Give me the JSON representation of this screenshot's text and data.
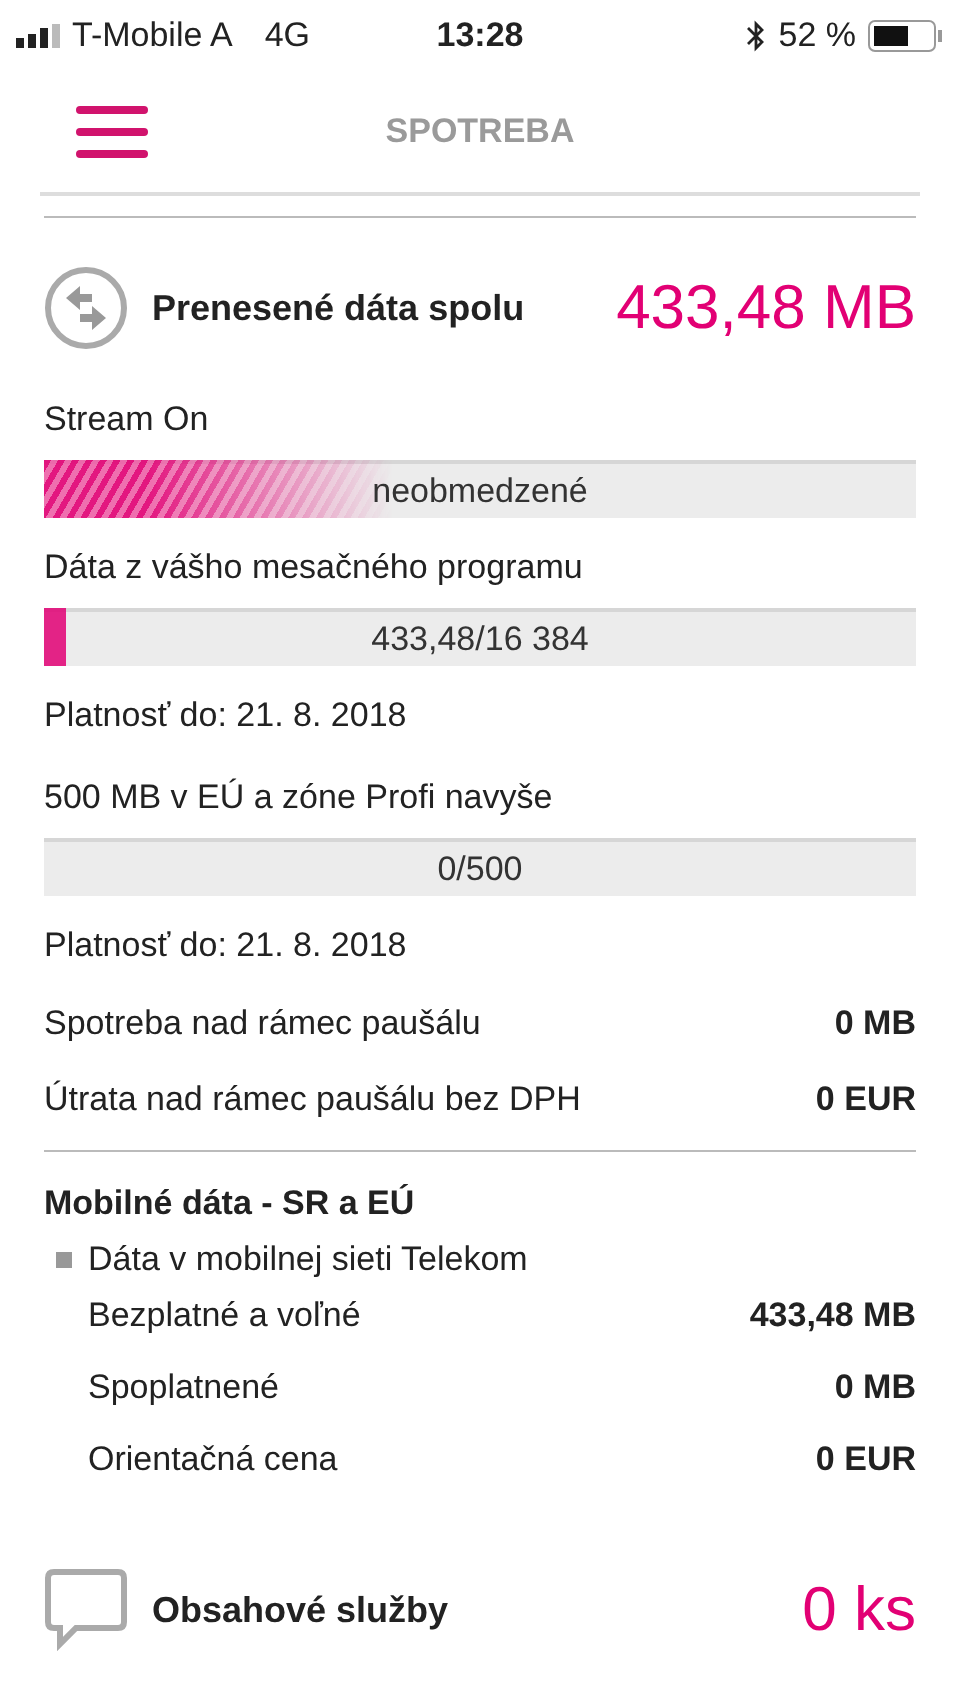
{
  "status_bar": {
    "carrier": "T-Mobile A",
    "network": "4G",
    "time": "13:28",
    "battery": "52 %"
  },
  "header": {
    "title": "SPOTREBA"
  },
  "data_section": {
    "title": "Prenesené dáta spolu",
    "total": "433,48 MB",
    "items": [
      {
        "kind": "meter",
        "label": "Stream On",
        "bar": {
          "kind": "unlimited",
          "level": 0.4,
          "text": "neobmedzené"
        }
      },
      {
        "kind": "meter",
        "label": "Dáta z vášho mesačného programu",
        "bar": {
          "kind": "quota",
          "level": 0.026,
          "text": "433,48/16 384"
        }
      },
      {
        "kind": "note",
        "label": "Platnosť do: 21. 8. 2018"
      },
      {
        "kind": "meter",
        "label": "500 MB v EÚ a zóne Profi navyše",
        "bar": {
          "kind": "quota",
          "text": "0/500"
        }
      },
      {
        "kind": "note",
        "label": "Platnosť do: 21. 8. 2018"
      },
      {
        "kind": "row",
        "label": "Spotreba nad rámec paušálu",
        "value": "0 MB"
      },
      {
        "kind": "row",
        "label": "Útrata nad rámec paušálu bez DPH",
        "value": "0 EUR"
      }
    ]
  },
  "mobile_data": {
    "title": "Mobilné dáta - SR a EÚ",
    "group": "Dáta v mobilnej sieti Telekom",
    "rows": [
      {
        "label": "Bezplatné a voľné",
        "value": "433,48 MB"
      },
      {
        "label": "Spoplatnené",
        "value": "0 MB"
      },
      {
        "label": "Orientačná cena",
        "value": "0 EUR"
      }
    ]
  },
  "content_section": {
    "title": "Obsahové služby",
    "total": "0 ks"
  }
}
